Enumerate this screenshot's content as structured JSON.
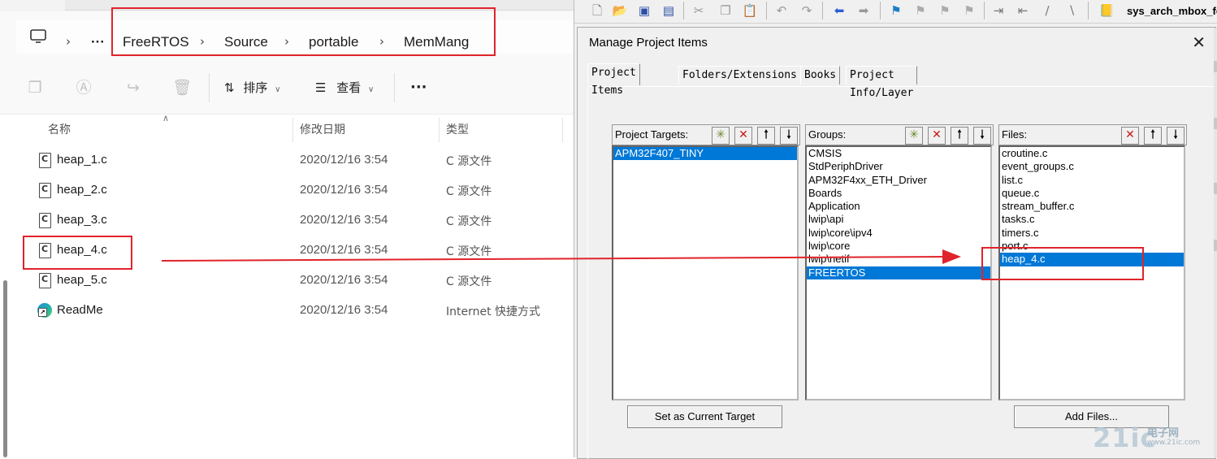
{
  "explorer": {
    "breadcrumb": [
      "FreeRTOS",
      "Source",
      "portable",
      "MemMang"
    ],
    "overflow": "···",
    "sort_label": "排序",
    "view_label": "查看",
    "more_label": "···",
    "columns": {
      "name": "名称",
      "modified": "修改日期",
      "type": "类型"
    },
    "files": [
      {
        "name": "heap_1.c",
        "date": "2020/12/16 3:54",
        "type": "C 源文件"
      },
      {
        "name": "heap_2.c",
        "date": "2020/12/16 3:54",
        "type": "C 源文件"
      },
      {
        "name": "heap_3.c",
        "date": "2020/12/16 3:54",
        "type": "C 源文件"
      },
      {
        "name": "heap_4.c",
        "date": "2020/12/16 3:54",
        "type": "C 源文件"
      },
      {
        "name": "heap_5.c",
        "date": "2020/12/16 3:54",
        "type": "C 源文件"
      },
      {
        "name": "ReadMe",
        "date": "2020/12/16 3:54",
        "type": "Internet 快捷方式"
      }
    ],
    "file_icon_letter": "C"
  },
  "uvision": {
    "toolbar_label": "sys_arch_mbox_fe",
    "dialog": {
      "title": "Manage Project Items",
      "tabs": [
        "Project Items",
        "Folders/Extensions",
        "Books",
        "Project Info/Layer"
      ],
      "targets_label": "Project Targets:",
      "targets": [
        "APM32F407_TINY"
      ],
      "groups_label": "Groups:",
      "groups": [
        "CMSIS",
        "StdPeriphDriver",
        "APM32F4xx_ETH_Driver",
        "Boards",
        "Application",
        "lwip\\api",
        "lwip\\core\\ipv4",
        "lwip\\core",
        "lwip\\netif",
        "FREERTOS"
      ],
      "files_label": "Files:",
      "files": [
        "croutine.c",
        "event_groups.c",
        "list.c",
        "queue.c",
        "stream_buffer.c",
        "tasks.c",
        "timers.c",
        "port.c",
        "heap_4.c"
      ],
      "set_target_button": "Set as Current Target",
      "add_files_button": "Add Files..."
    }
  },
  "watermark": {
    "logo": "21ic",
    "cn": "电子网",
    "url": "www.21ic.com"
  },
  "colors": {
    "highlight": "#e0242b",
    "selection": "#0078d7"
  }
}
